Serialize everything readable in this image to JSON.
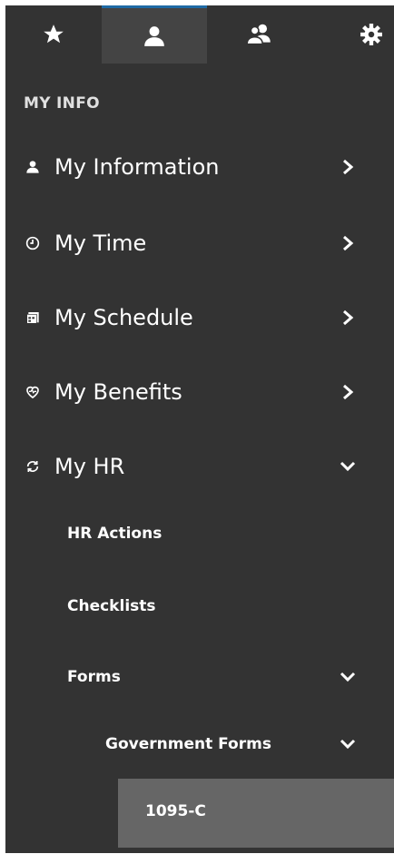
{
  "tabs": [
    {
      "icon": "star-icon",
      "active": false
    },
    {
      "icon": "user-icon",
      "active": true
    },
    {
      "icon": "users-icon",
      "active": false
    },
    {
      "icon": "gear-icon",
      "active": false
    }
  ],
  "section_title": "MY INFO",
  "menu": {
    "my_information": "My Information",
    "my_time": "My Time",
    "my_schedule": "My Schedule",
    "my_benefits": "My Benefits",
    "my_hr": "My HR",
    "hr_actions": "HR Actions",
    "checklists": "Checklists",
    "forms": "Forms",
    "government_forms": "Government Forms",
    "form_1095c": "1095-C"
  },
  "colors": {
    "panel_bg": "#333333",
    "active_tab_bg": "#444444",
    "active_tab_accent": "#1f6aa5",
    "selected_bg": "#666666"
  }
}
